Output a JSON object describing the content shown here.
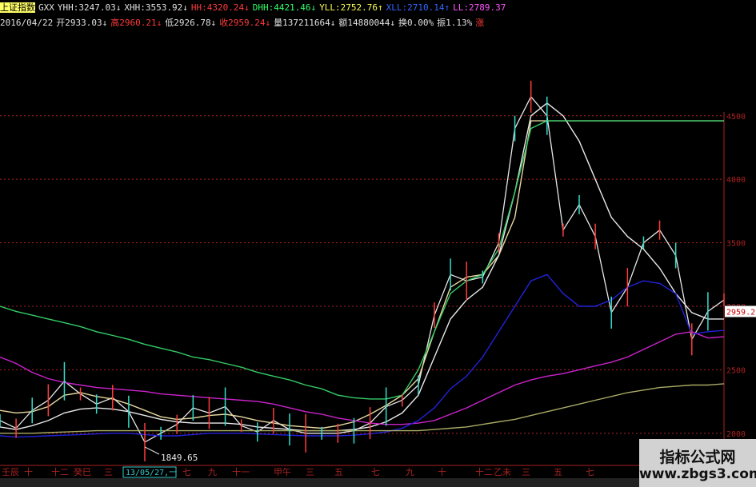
{
  "header_line1": [
    {
      "label": "上证指数",
      "color": "#000000",
      "bg": "#ffff66"
    },
    {
      "label": "GXX",
      "color": "#e0e0e0"
    },
    {
      "label": "YHH:3247.03↓",
      "color": "#e0e0e0"
    },
    {
      "label": "XHH:3553.92↓",
      "color": "#e0e0e0"
    },
    {
      "label": "HH:4320.24↓",
      "color": "#ff3b3b"
    },
    {
      "label": "DHH:4421.46↓",
      "color": "#33ff66"
    },
    {
      "label": "YLL:2752.76↑",
      "color": "#ffff55"
    },
    {
      "label": "XLL:2710.14↑",
      "color": "#3366ff"
    },
    {
      "label": "LL:2789.37",
      "color": "#ff55ff"
    }
  ],
  "header_line2": [
    {
      "label": "2016/04/22",
      "color": "#e0e0e0"
    },
    {
      "label": "开2933.03↓",
      "color": "#e0e0e0"
    },
    {
      "label": "高2960.21↓",
      "color": "#ff3b3b"
    },
    {
      "label": "低2926.78↓",
      "color": "#e0e0e0"
    },
    {
      "label": "收2959.24↓",
      "color": "#ff3b3b"
    },
    {
      "label": "量137211664↓",
      "color": "#e0e0e0"
    },
    {
      "label": "额14880044↓",
      "color": "#e0e0e0"
    },
    {
      "label": "换0.00%",
      "color": "#e0e0e0"
    },
    {
      "label": "振1.13%",
      "color": "#e0e0e0"
    },
    {
      "label": "涨",
      "color": "#ff3b3b"
    }
  ],
  "y_axis": {
    "ticks": [
      "4500",
      "4000",
      "3500",
      "3000",
      "2500",
      "2000"
    ],
    "current_price": "2959.2"
  },
  "x_axis": {
    "labels": [
      "壬辰",
      "十",
      "十二",
      "癸巳",
      "三",
      "五",
      "七",
      "九",
      "十一",
      "甲午",
      "三",
      "五",
      "七",
      "九",
      "十",
      "十二",
      "乙未",
      "三",
      "五",
      "七"
    ],
    "cursor_date": "13/05/27,一"
  },
  "annotations": {
    "low_point": "1849.65"
  },
  "watermark": {
    "cn": "指标公式网",
    "en": "www.zbgs3.com"
  },
  "colors": {
    "red": "#ff3b3b",
    "green": "#33cc66",
    "blue": "#2222dd",
    "magenta": "#cc22cc",
    "white": "#e8e8e8",
    "tan": "#e8d8a0",
    "olive": "#aaaa66",
    "axis": "#aa2222"
  },
  "chart_data": {
    "type": "line",
    "y_range": [
      1800,
      4550
    ],
    "x": [
      0,
      20,
      40,
      60,
      80,
      100,
      120,
      140,
      160,
      180,
      200,
      220,
      240,
      260,
      280,
      300,
      320,
      340,
      360,
      380,
      400,
      420,
      440,
      460,
      480,
      500,
      520,
      540,
      560,
      580,
      600,
      620,
      640,
      660,
      680,
      700,
      720,
      740,
      760,
      780,
      800,
      820,
      840,
      860,
      880,
      900
    ],
    "series": [
      {
        "name": "price",
        "color": "#e8e8e8",
        "values": [
          2100,
          2040,
          2180,
          2260,
          2410,
          2310,
          2230,
          2280,
          2170,
          1930,
          2000,
          2070,
          2200,
          2160,
          2210,
          2060,
          2010,
          2100,
          2030,
          2000,
          2000,
          2000,
          2020,
          2080,
          2210,
          2260,
          2380,
          2930,
          3250,
          3200,
          3230,
          3500,
          4400,
          4650,
          4500,
          3600,
          3800,
          3550,
          2950,
          3150,
          3500,
          3600,
          3400,
          2740,
          2960,
          3050
        ]
      },
      {
        "name": "ma_tan",
        "color": "#e8d8a0",
        "values": [
          2180,
          2160,
          2170,
          2210,
          2300,
          2320,
          2290,
          2270,
          2230,
          2180,
          2130,
          2110,
          2120,
          2140,
          2150,
          2130,
          2100,
          2080,
          2060,
          2050,
          2040,
          2060,
          2090,
          2150,
          2220,
          2300,
          2430,
          2800,
          3150,
          3230,
          3250,
          3400,
          3700,
          4460,
          4460,
          4460,
          4460,
          4460,
          4460,
          4460,
          4460,
          4460,
          4460,
          4460,
          4460,
          4460
        ]
      },
      {
        "name": "ma_white",
        "color": "#e8e8e8",
        "values": [
          2050,
          2030,
          2060,
          2100,
          2160,
          2190,
          2200,
          2190,
          2170,
          2140,
          2110,
          2090,
          2080,
          2080,
          2080,
          2070,
          2050,
          2040,
          2030,
          2020,
          2020,
          2020,
          2030,
          2050,
          2090,
          2160,
          2300,
          2600,
          2900,
          3050,
          3150,
          3400,
          3900,
          4500,
          4600,
          4500,
          4300,
          4000,
          3700,
          3550,
          3450,
          3300,
          3100,
          2950,
          2900,
          2900
        ]
      },
      {
        "name": "ma_green",
        "color": "#33cc66",
        "values": [
          3000,
          2960,
          2930,
          2900,
          2870,
          2840,
          2800,
          2770,
          2740,
          2700,
          2670,
          2640,
          2600,
          2580,
          2550,
          2520,
          2480,
          2450,
          2420,
          2380,
          2350,
          2300,
          2280,
          2270,
          2270,
          2300,
          2500,
          2800,
          3100,
          3200,
          3250,
          3450,
          3900,
          4400,
          4460,
          4460,
          4460,
          4460,
          4460,
          4460,
          4460,
          4460,
          4460,
          4460,
          4460,
          4460
        ]
      },
      {
        "name": "ma_magenta",
        "color": "#cc22cc",
        "values": [
          2600,
          2550,
          2480,
          2430,
          2400,
          2380,
          2360,
          2350,
          2340,
          2330,
          2310,
          2300,
          2290,
          2280,
          2270,
          2260,
          2250,
          2230,
          2200,
          2170,
          2150,
          2120,
          2100,
          2080,
          2070,
          2070,
          2080,
          2100,
          2150,
          2200,
          2260,
          2320,
          2380,
          2420,
          2450,
          2470,
          2500,
          2530,
          2560,
          2600,
          2660,
          2720,
          2780,
          2800,
          2750,
          2760
        ]
      },
      {
        "name": "ma_blue",
        "color": "#2222dd",
        "values": [
          1980,
          1970,
          1975,
          1980,
          1985,
          1990,
          1995,
          2000,
          2000,
          1990,
          1980,
          1980,
          1990,
          2000,
          2000,
          2000,
          1995,
          1990,
          1985,
          1980,
          1980,
          1980,
          1985,
          1995,
          2010,
          2040,
          2100,
          2200,
          2350,
          2450,
          2600,
          2800,
          3000,
          3200,
          3250,
          3100,
          3000,
          3000,
          3050,
          3150,
          3200,
          3180,
          3100,
          2780,
          2800,
          2810
        ]
      },
      {
        "name": "ma_olive",
        "color": "#aaaa66",
        "values": [
          2000,
          2000,
          2000,
          2005,
          2010,
          2015,
          2020,
          2020,
          2020,
          2020,
          2020,
          2020,
          2020,
          2020,
          2020,
          2020,
          2020,
          2020,
          2020,
          2020,
          2020,
          2020,
          2020,
          2020,
          2020,
          2020,
          2020,
          2030,
          2040,
          2050,
          2070,
          2090,
          2110,
          2140,
          2170,
          2200,
          2230,
          2260,
          2290,
          2320,
          2340,
          2360,
          2370,
          2380,
          2380,
          2390
        ]
      }
    ]
  }
}
